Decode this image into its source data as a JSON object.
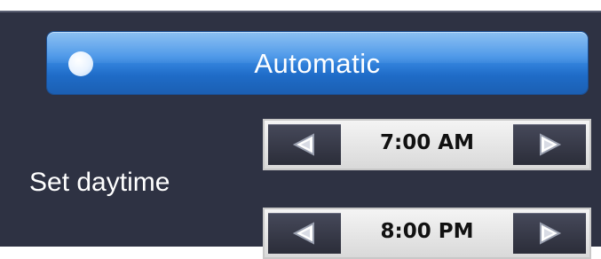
{
  "mode_button": {
    "label": "Automatic",
    "state": "on",
    "color": "#3c8ee6"
  },
  "daytime": {
    "label": "Set daytime",
    "start": {
      "value": "7:00 AM",
      "decrement_icon": "arrow-left-icon",
      "increment_icon": "arrow-right-icon"
    },
    "end": {
      "value": "8:00 PM",
      "decrement_icon": "arrow-left-icon",
      "increment_icon": "arrow-right-icon"
    }
  },
  "colors": {
    "background": "#2e3243",
    "button_dark": "#2b2d39",
    "stepper_light": "#e8e8e8"
  }
}
